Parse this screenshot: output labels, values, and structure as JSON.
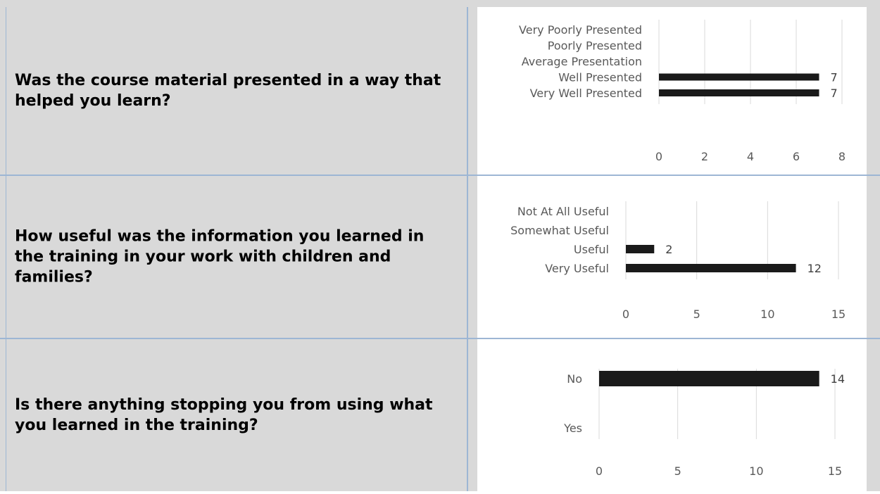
{
  "rows": [
    {
      "question": "Was the course material presented in a way that helped you learn?"
    },
    {
      "question": "How useful was the information you learned in the training in your work with children and families?"
    },
    {
      "question": "Is there anything stopping you from using what you learned in the training?"
    }
  ],
  "colors": {
    "bar": "#1a1a1a",
    "grid": "#d9d9d9",
    "label": "#595959",
    "question_bg": "#d9d9d9",
    "border": "#9db6d4"
  },
  "chart_data": [
    {
      "type": "bar",
      "orientation": "horizontal",
      "categories": [
        "Very Poorly Presented",
        "Poorly Presented",
        "Average Presentation",
        "Well Presented",
        "Very Well Presented"
      ],
      "values": [
        0,
        0,
        0,
        7,
        7
      ],
      "data_labels": [
        "",
        "",
        "",
        "7",
        "7"
      ],
      "xlim": [
        0,
        8
      ],
      "xticks": [
        0,
        2,
        4,
        6,
        8
      ],
      "grid": true
    },
    {
      "type": "bar",
      "orientation": "horizontal",
      "categories": [
        "Not At All Useful",
        "Somewhat Useful",
        "Useful",
        "Very Useful"
      ],
      "values": [
        0,
        0,
        2,
        12
      ],
      "data_labels": [
        "",
        "",
        "2",
        "12"
      ],
      "xlim": [
        0,
        15
      ],
      "xticks": [
        0,
        5,
        10,
        15
      ],
      "grid": true
    },
    {
      "type": "bar",
      "orientation": "horizontal",
      "categories": [
        "No",
        "Yes"
      ],
      "values": [
        14,
        0
      ],
      "data_labels": [
        "14",
        ""
      ],
      "xlim": [
        0,
        15
      ],
      "xticks": [
        0,
        5,
        10,
        15
      ],
      "grid": true
    }
  ]
}
